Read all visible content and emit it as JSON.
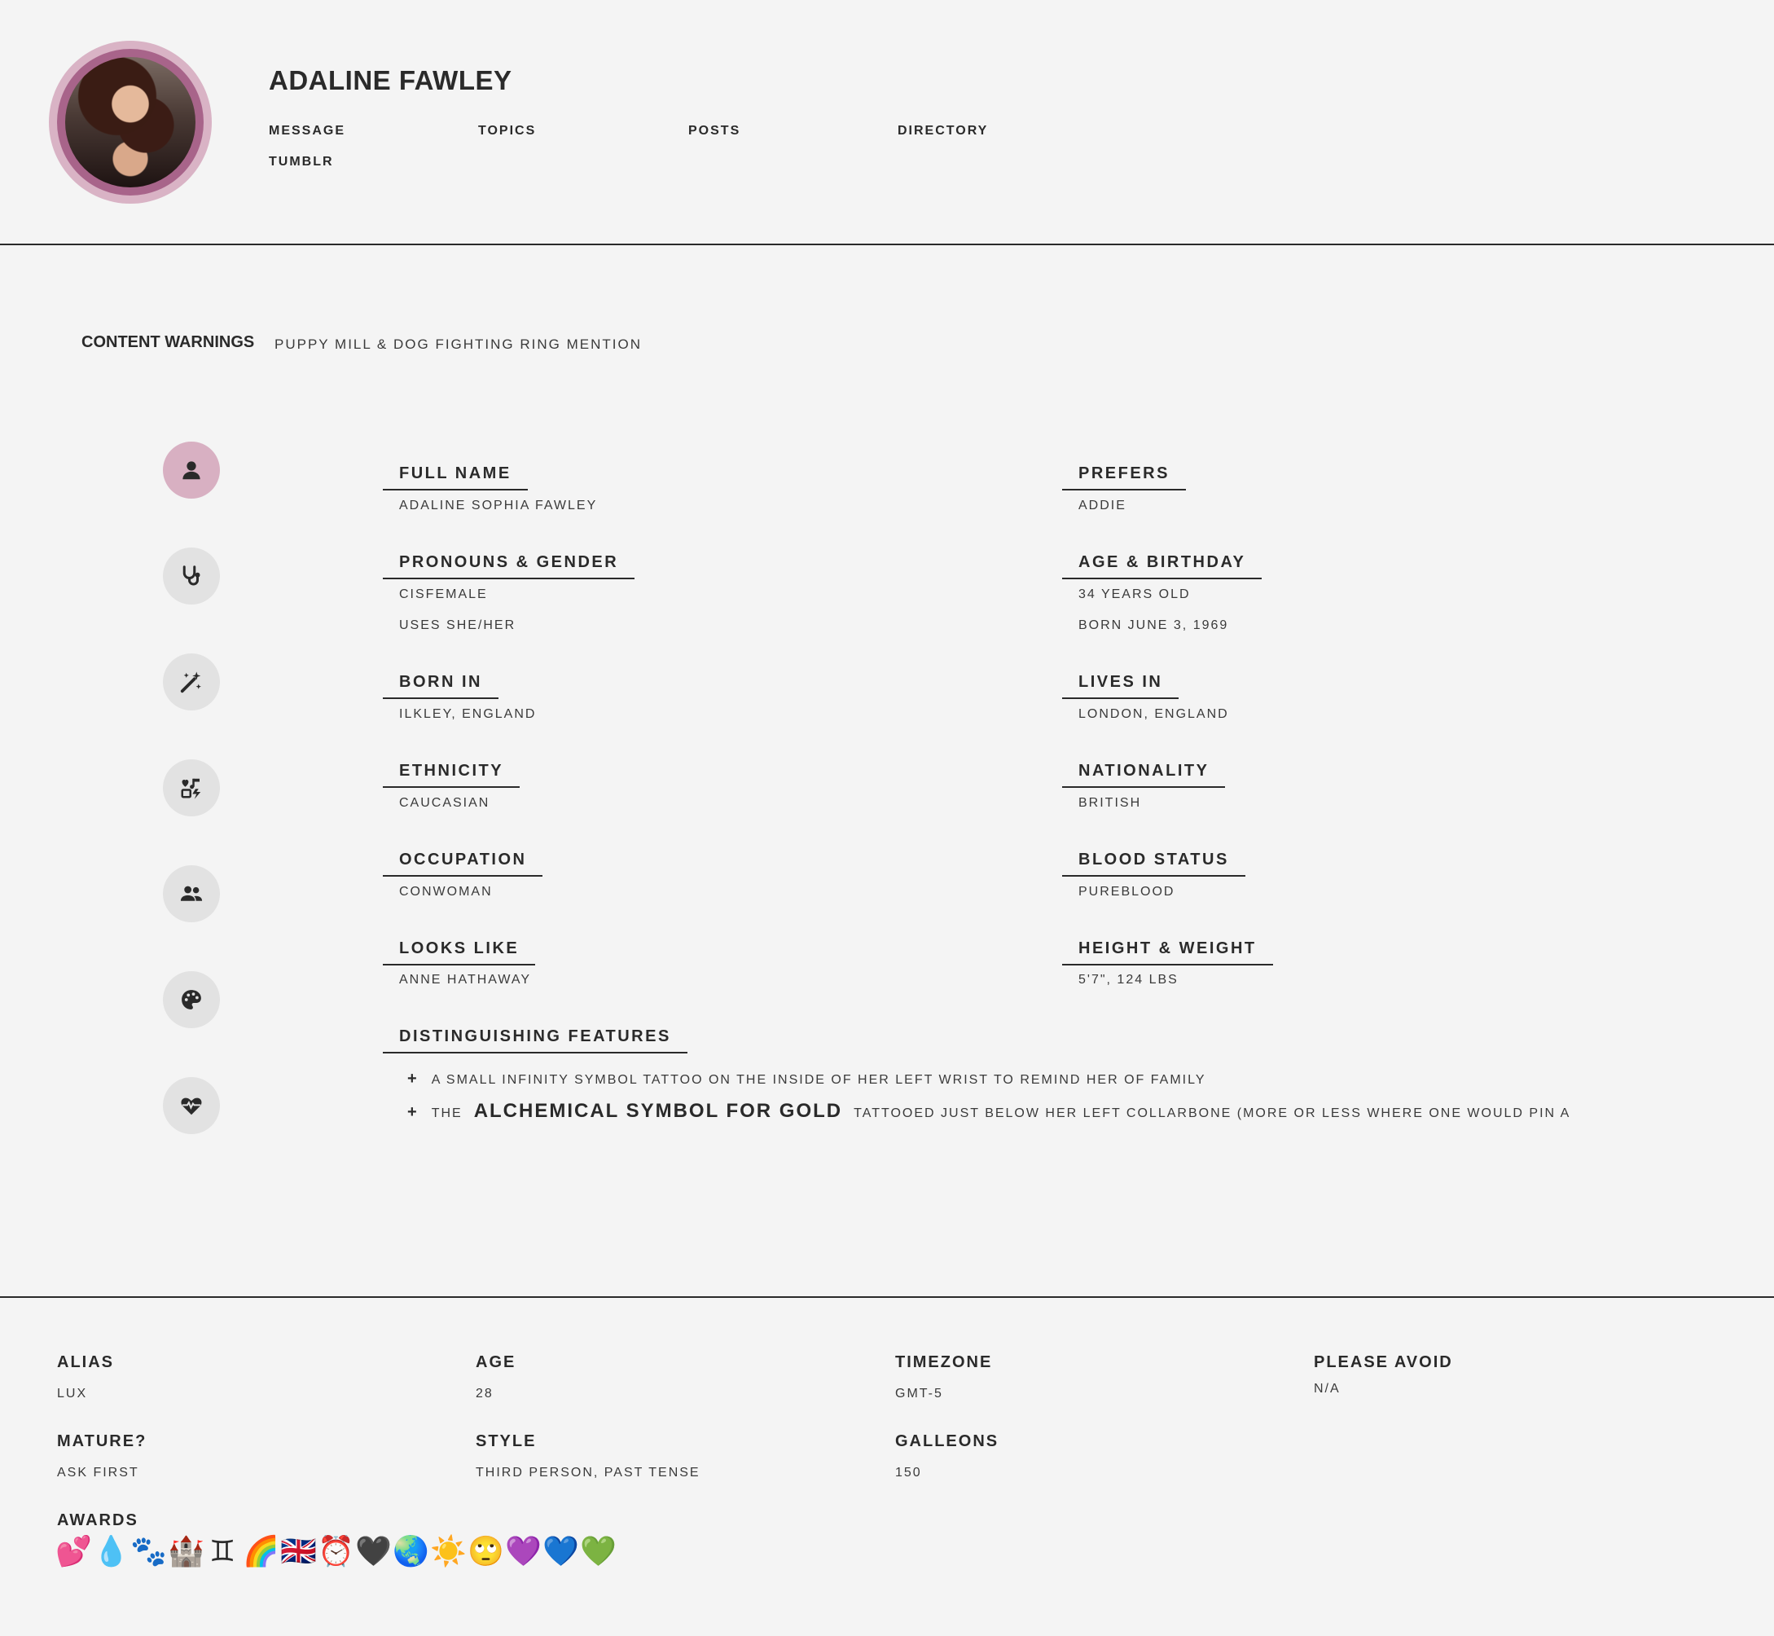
{
  "header": {
    "name": "ADALINE FAWLEY",
    "nav": [
      "MESSAGE",
      "TOPICS",
      "POSTS",
      "DIRECTORY",
      "TUMBLR"
    ]
  },
  "content_warnings": {
    "label": "CONTENT WARNINGS",
    "text": "PUPPY MILL & DOG FIGHTING RING MENTION"
  },
  "icons": [
    "user-icon",
    "stethoscope-icon",
    "magic-wand-icon",
    "music-heart-icon",
    "users-icon",
    "palette-icon",
    "heart-pulse-icon"
  ],
  "fields": {
    "full_name": {
      "title": "FULL NAME",
      "values": [
        "ADALINE SOPHIA FAWLEY"
      ]
    },
    "prefers": {
      "title": "PREFERS",
      "values": [
        "ADDIE"
      ]
    },
    "pronouns": {
      "title": "PRONOUNS & GENDER",
      "values": [
        "CISFEMALE",
        "USES SHE/HER"
      ]
    },
    "age_birthday": {
      "title": "AGE & BIRTHDAY",
      "values": [
        "34 YEARS OLD",
        "BORN JUNE 3, 1969"
      ]
    },
    "born_in": {
      "title": "BORN IN",
      "values": [
        "ILKLEY, ENGLAND"
      ]
    },
    "lives_in": {
      "title": "LIVES IN",
      "values": [
        "LONDON, ENGLAND"
      ]
    },
    "ethnicity": {
      "title": "ETHNICITY",
      "values": [
        "CAUCASIAN"
      ]
    },
    "nationality": {
      "title": "NATIONALITY",
      "values": [
        "BRITISH"
      ]
    },
    "occupation": {
      "title": "OCCUPATION",
      "values": [
        "CONWOMAN"
      ]
    },
    "blood_status": {
      "title": "BLOOD STATUS",
      "values": [
        "PUREBLOOD"
      ]
    },
    "looks_like": {
      "title": "LOOKS LIKE",
      "values": [
        "ANNE HATHAWAY"
      ]
    },
    "height_weight": {
      "title": "HEIGHT & WEIGHT",
      "values": [
        "5'7\", 124 LBS"
      ]
    }
  },
  "features": {
    "title": "DISTINGUISHING FEATURES",
    "plus": "+",
    "item1": "A SMALL INFINITY SYMBOL TATTOO ON THE INSIDE OF HER LEFT WRIST TO REMIND HER OF FAMILY",
    "item2_pre": "THE",
    "item2_emph": "ALCHEMICAL SYMBOL FOR GOLD",
    "item2_post": "TATTOOED JUST BELOW HER LEFT COLLARBONE (MORE OR LESS WHERE ONE WOULD PIN A"
  },
  "footer": {
    "alias": {
      "title": "ALIAS",
      "value": "LUX"
    },
    "age": {
      "title": "AGE",
      "value": "28"
    },
    "timezone": {
      "title": "TIMEZONE",
      "value": "GMT-5"
    },
    "avoid": {
      "title": "PLEASE AVOID",
      "value": "N/A"
    },
    "mature": {
      "title": "MATURE?",
      "value": "ASK FIRST"
    },
    "style": {
      "title": "STYLE",
      "value": "THIRD PERSON, PAST TENSE"
    },
    "galleons": {
      "title": "GALLEONS",
      "value": "150"
    },
    "awards": {
      "title": "AWARDS",
      "items": [
        "💕",
        "💧",
        "🐾",
        "🏰",
        "♊",
        "🌈",
        "🇬🇧",
        "⏰",
        "🖤",
        "🌏",
        "☀️",
        "🙄",
        "💜",
        "💙",
        "💚"
      ]
    }
  },
  "colors": {
    "accent": "#a8648a",
    "accent_light": "#d8b0c2",
    "text": "#2a2a2a",
    "background": "#f4f4f4"
  }
}
